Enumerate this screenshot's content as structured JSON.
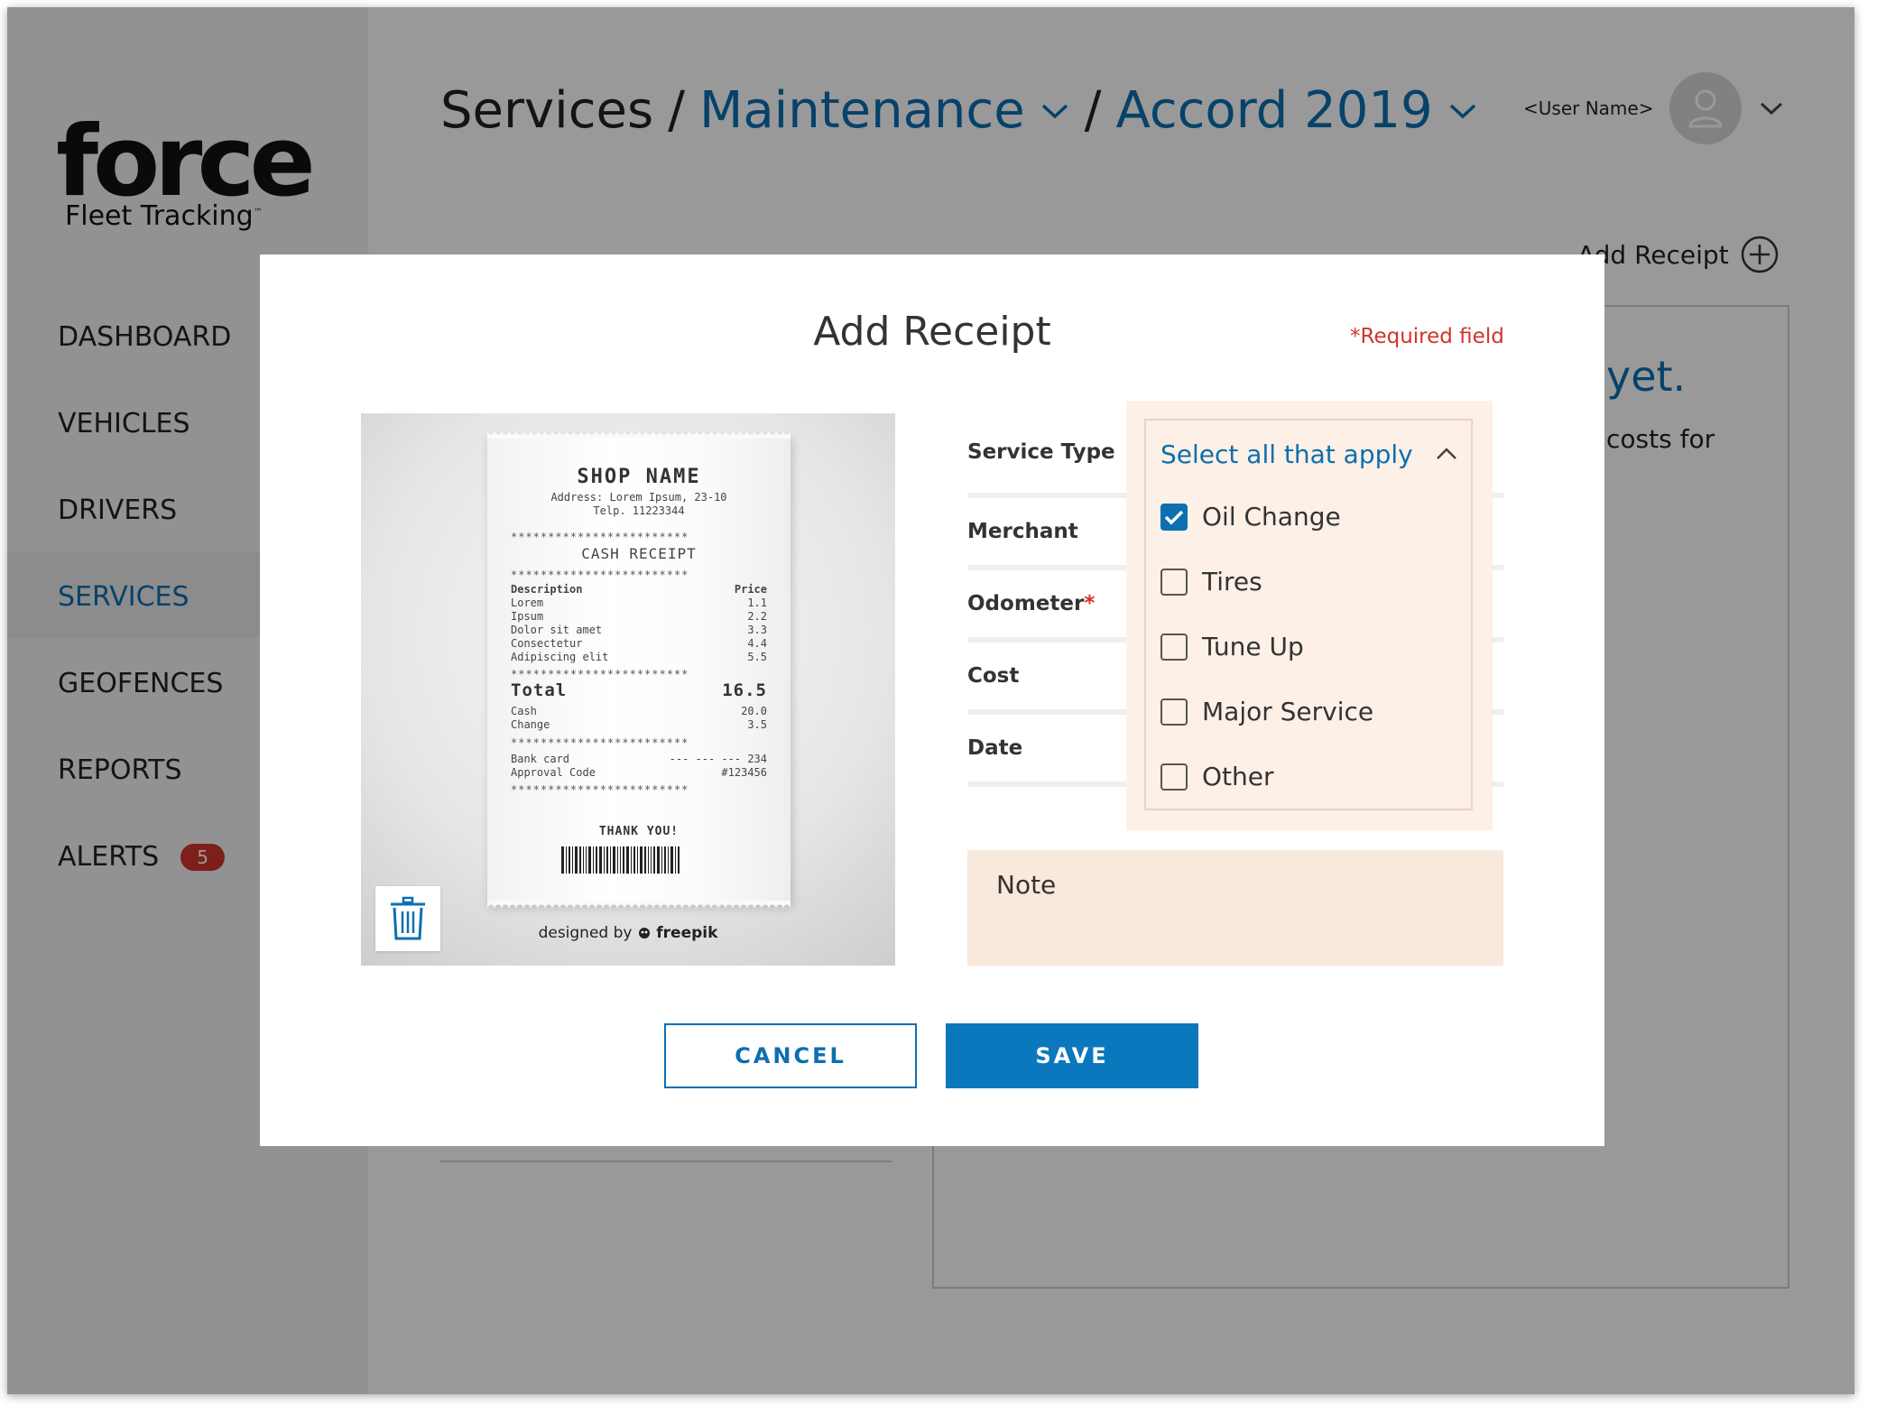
{
  "app": {
    "logo_word": "force",
    "logo_tagline": "Fleet Tracking",
    "logo_tm": "™"
  },
  "nav": {
    "items": [
      {
        "label": "DASHBOARD"
      },
      {
        "label": "VEHICLES"
      },
      {
        "label": "DRIVERS"
      },
      {
        "label": "SERVICES",
        "active": true
      },
      {
        "label": "GEOFENCES"
      },
      {
        "label": "REPORTS"
      },
      {
        "label": "ALERTS",
        "badge": "5"
      }
    ]
  },
  "breadcrumb": {
    "root": "Services",
    "sep": "/",
    "section": "Maintenance",
    "vehicle": "Accord 2019"
  },
  "user": {
    "name": "<User Name>"
  },
  "page": {
    "add_receipt": "Add Receipt",
    "empty_title": "yet.",
    "empty_text": "costs for"
  },
  "modal": {
    "title": "Add Receipt",
    "required_note": "*Required field",
    "fields": {
      "service_type": "Service Type",
      "merchant": "Merchant",
      "odometer": "Odometer",
      "odometer_required": "*",
      "cost": "Cost",
      "date": "Date"
    },
    "dropdown": {
      "placeholder": "Select all that apply",
      "options": [
        {
          "label": "Oil Change",
          "checked": true
        },
        {
          "label": "Tires",
          "checked": false
        },
        {
          "label": "Tune Up",
          "checked": false
        },
        {
          "label": "Major Service",
          "checked": false
        },
        {
          "label": "Other",
          "checked": false
        }
      ]
    },
    "note_placeholder": "Note",
    "cancel_label": "CANCEL",
    "save_label": "SAVE"
  },
  "receipt_image": {
    "shop_name": "SHOP NAME",
    "address": "Address: Lorem Ipsum, 23-10",
    "phone": "Telp. 11223344",
    "heading": "CASH RECEIPT",
    "stars": "************************",
    "col_desc": "Description",
    "col_price": "Price",
    "items": [
      {
        "name": "Lorem",
        "price": "1.1"
      },
      {
        "name": "Ipsum",
        "price": "2.2"
      },
      {
        "name": "Dolor sit amet",
        "price": "3.3"
      },
      {
        "name": "Consectetur",
        "price": "4.4"
      },
      {
        "name": "Adipiscing elit",
        "price": "5.5"
      }
    ],
    "total_label": "Total",
    "total_value": "16.5",
    "cash_label": "Cash",
    "cash_value": "20.0",
    "change_label": "Change",
    "change_value": "3.5",
    "bank_label": "Bank card",
    "bank_value": "--- --- --- 234",
    "approval_label": "Approval Code",
    "approval_value": "#123456",
    "thanks": "THANK YOU!",
    "credit_prefix": "designed by",
    "credit_brand": "freepik"
  },
  "colors": {
    "accent": "#0b6fb0",
    "button": "#0b78bd",
    "required": "#d0342c",
    "dropdown_bg": "#fdf0e6",
    "note_bg": "#f9e8dc",
    "badge": "#d0342c"
  }
}
